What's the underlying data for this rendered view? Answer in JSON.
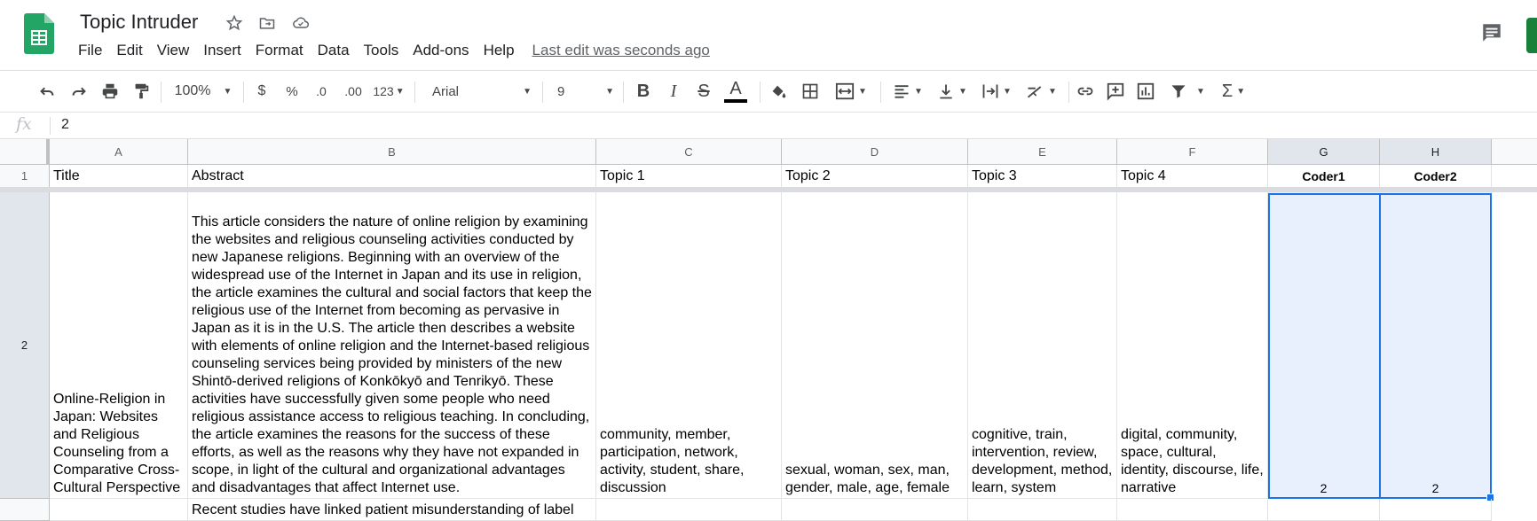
{
  "app": {
    "title": "Topic Intruder",
    "last_edit": "Last edit was seconds ago",
    "icons": [
      "sheets-logo-icon",
      "star-icon",
      "move-to-folder-icon",
      "cloud-status-icon",
      "comment-icon"
    ],
    "brand_color": "#188038"
  },
  "menu": [
    "File",
    "Edit",
    "View",
    "Insert",
    "Format",
    "Data",
    "Tools",
    "Add-ons",
    "Help"
  ],
  "toolbar": {
    "zoom": "100%",
    "currency": "$",
    "percent": "%",
    "decrease_decimals": ".0",
    "increase_decimals": ".00",
    "more_formats": "123",
    "font": "Arial",
    "font_size": "9",
    "icons": [
      "undo-icon",
      "redo-icon",
      "print-icon",
      "paint-format-icon",
      "bold-icon",
      "italic-icon",
      "strikethrough-icon",
      "text-color-icon",
      "fill-color-icon",
      "borders-icon",
      "merge-cells-icon",
      "horizontal-align-icon",
      "vertical-align-icon",
      "text-wrapping-icon",
      "text-rotation-icon",
      "insert-link-icon",
      "insert-comment-icon",
      "insert-chart-icon",
      "filter-icon",
      "functions-icon"
    ]
  },
  "formula_bar": {
    "fx": "fx",
    "value": "2"
  },
  "grid": {
    "columns": [
      "A",
      "B",
      "C",
      "D",
      "E",
      "F",
      "G",
      "H"
    ],
    "rows": [
      "1",
      "2"
    ],
    "header_row": [
      "Title",
      "Abstract",
      "Topic 1",
      "Topic 2",
      "Topic 3",
      "Topic 4",
      "Coder1",
      "Coder2"
    ],
    "row2": {
      "title": "Online-Religion in Japan: Websites and Religious Counseling from a Comparative Cross-Cultural Perspective",
      "abstract": "This article considers the nature of online religion by examining the websites and religious counseling activities conducted by new Japanese religions. Beginning with an overview of the widespread use of the Internet in Japan and its use in religion, the article examines the cultural and social factors that keep the religious use of the Internet from becoming as pervasive in Japan as it is in the U.S. The article then describes a website with elements of online religion and the Internet-based religious counseling services being provided by ministers of the new Shintō-derived religions of Konkōkyō and Tenrikyō. These activities have successfully given some people who need religious assistance access to religious teaching. In concluding, the article examines the reasons for the success of these efforts, as well as the reasons why they have not expanded in scope, in light of the cultural and organizational advantages and disadvantages that affect Internet use.",
      "topic1": "community, member, participation, network, activity, student, share, discussion",
      "topic2": "sexual, woman, sex, man, gender, male, age, female",
      "topic3": "cognitive, train, intervention, review, development, method, learn, system",
      "topic4": "digital, community, space, cultural, identity, discourse, life, narrative",
      "coder1": "2",
      "coder2": "2"
    },
    "row3_abstract_partial": "Recent studies have linked patient misunderstanding of label",
    "selection_color": "#1a73e8"
  }
}
